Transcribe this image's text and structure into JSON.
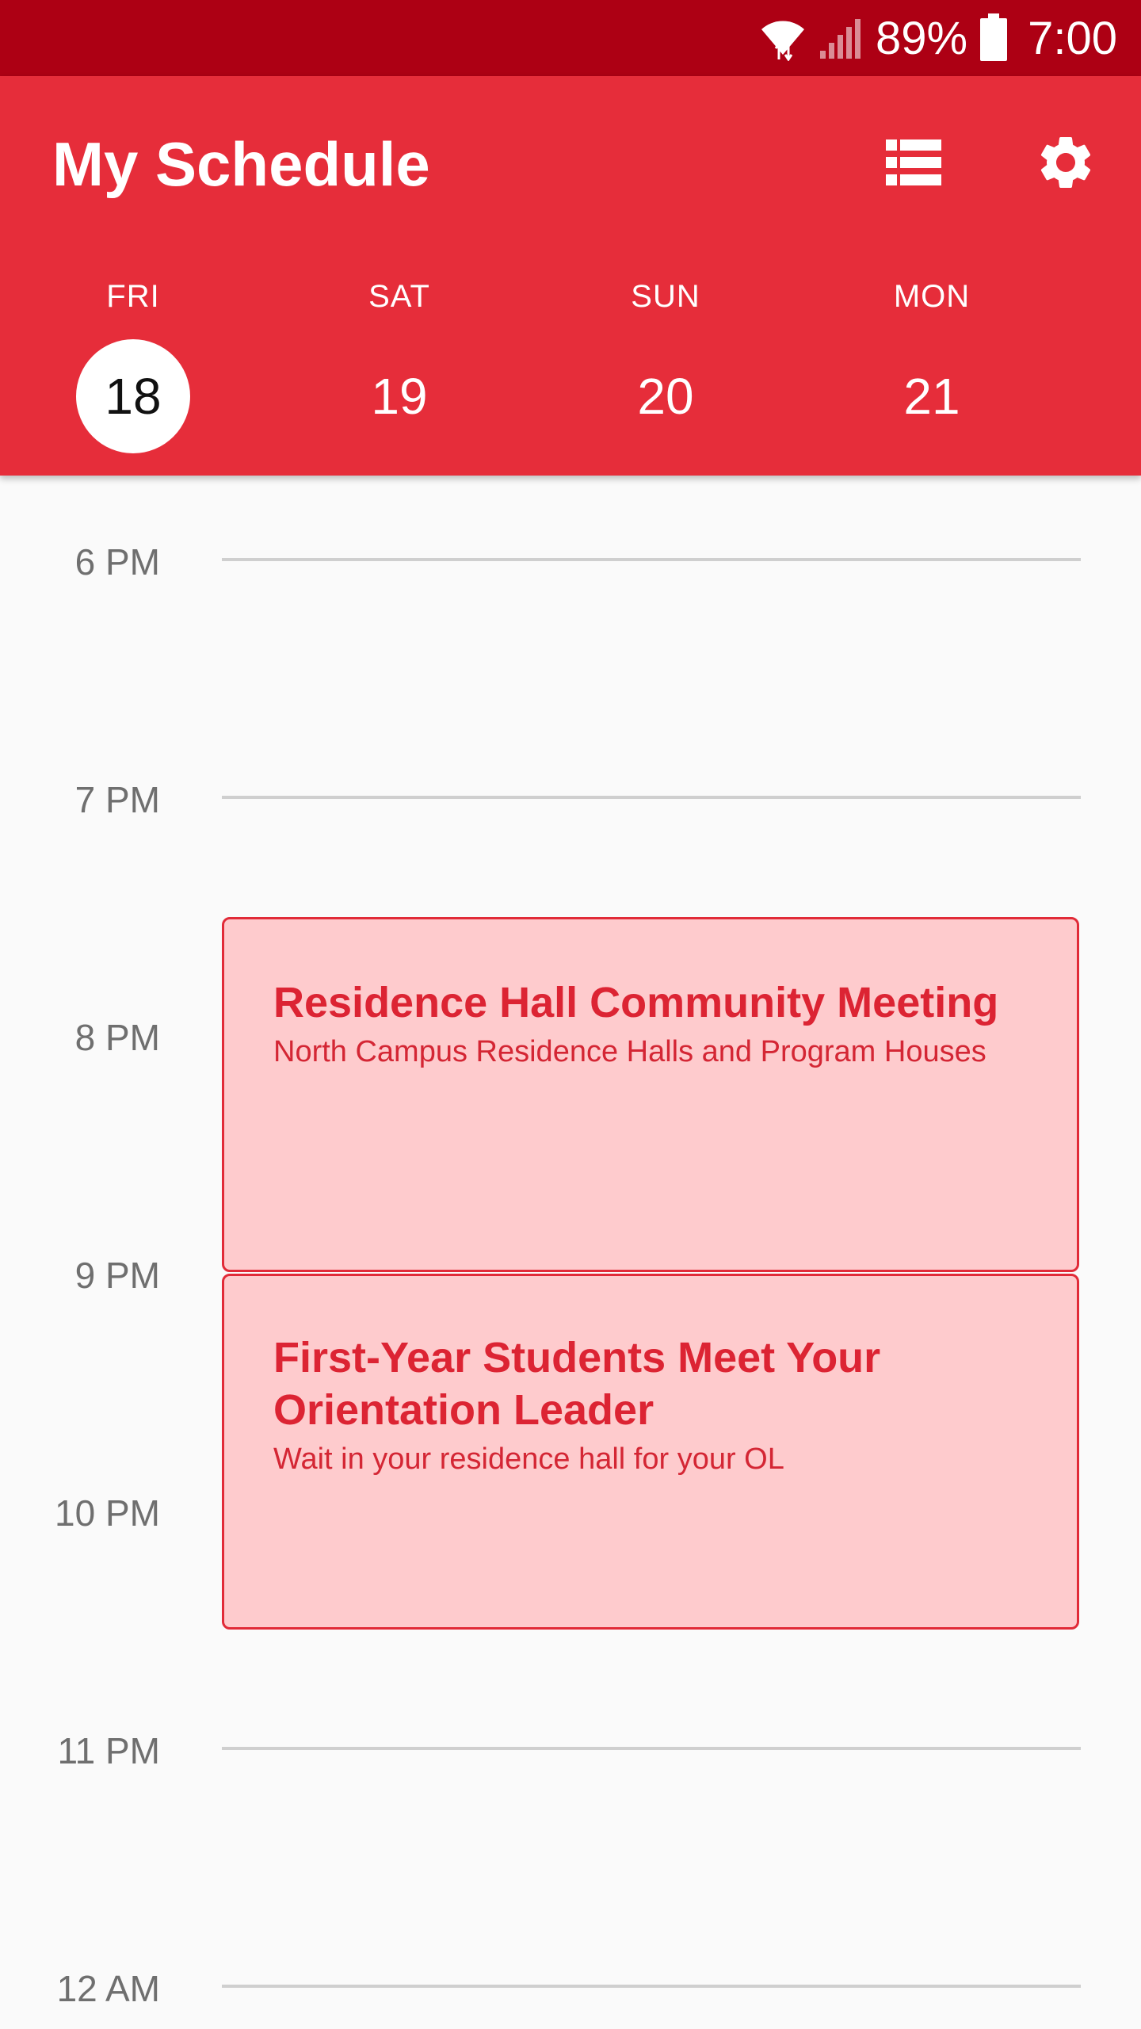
{
  "status_bar": {
    "battery_percent": "89%",
    "time": "7:00",
    "icons": [
      "wifi-icon",
      "cell-signal-icon",
      "battery-icon"
    ]
  },
  "app_bar": {
    "title": "My Schedule",
    "actions": [
      "list-view-icon",
      "settings-gear-icon"
    ],
    "colors": {
      "primary": "#e62d3a",
      "status_bar": "#ad0014"
    }
  },
  "days": [
    {
      "name": "FRI",
      "number": "18",
      "selected": true
    },
    {
      "name": "SAT",
      "number": "19",
      "selected": false
    },
    {
      "name": "SUN",
      "number": "20",
      "selected": false
    },
    {
      "name": "MON",
      "number": "21",
      "selected": false
    }
  ],
  "timeline": {
    "hours": [
      "6 PM",
      "7 PM",
      "8 PM",
      "9 PM",
      "10 PM",
      "11 PM",
      "12 AM"
    ]
  },
  "events": [
    {
      "title": "Residence Hall Community Meeting",
      "location": "North Campus Residence Halls and Program Houses"
    },
    {
      "title": "First-Year Students Meet Your Orientation Leader",
      "location": "Wait in your residence hall for your OL"
    }
  ]
}
